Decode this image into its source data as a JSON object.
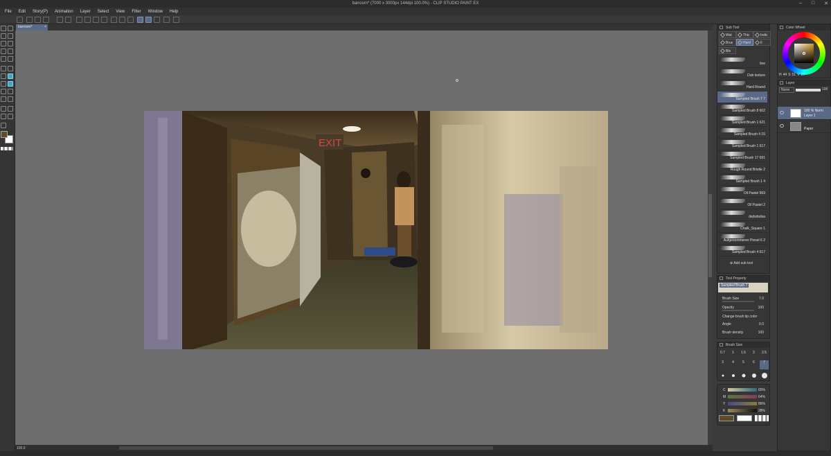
{
  "window": {
    "title": "barroom* (7000 x 3000px 144dpi 100.0%) - CLIP STUDIO PAINT EX",
    "controls": [
      "–",
      "□",
      "✕"
    ]
  },
  "menu": [
    "File",
    "Edit",
    "Story(P)",
    "Animation",
    "Layer",
    "Select",
    "View",
    "Filter",
    "Window",
    "Help"
  ],
  "document_tab": {
    "label": "barroom*",
    "close": "×"
  },
  "status": {
    "zoom": "100.0"
  },
  "colors": {
    "main_color": "#5e4c2a",
    "sub_color": "#ffffff",
    "accent": "#5a6a86",
    "canvas_bg": "#6d6d6d"
  },
  "sub_tool_panel": {
    "title": "Sub Tool",
    "tabs": [
      "Wat",
      "Thic",
      "Indic",
      "Brus",
      "Hard",
      "Il",
      "Ble"
    ],
    "brushes": [
      "line",
      "Dub texture",
      "Hard Round",
      "Sampled Brush 7 7",
      "Sampled Brush 8 602",
      "Sampled Brush 1 621",
      "Sampled Brush 4 15",
      "Sampled Brush 1 617",
      "Sampled Brush 17 691",
      "Rough Round Bristle 2",
      "Sampled Brush 1 4",
      "Oil Pastel 569",
      "Oil Pastel 2",
      "dsdsdsdsa",
      "Chalk_Square 1",
      "Aufgenommener Pinsel 6 2",
      "Sampled Brush 4 617"
    ],
    "selected_index": 3,
    "add_label": "Add sub tool"
  },
  "tool_property": {
    "title": "Tool Property",
    "brush_name": "Sampled Brush 7",
    "brush_size_label": "Brush Size",
    "brush_size": "7.0",
    "opacity_label": "Opacity",
    "opacity": "100",
    "change_tip_label": "Change brush tip color",
    "angle_label": "Angle",
    "angle": "0.0",
    "density_label": "Brush density",
    "density": "100"
  },
  "brush_size_panel": {
    "title": "Brush Size",
    "row1": [
      "0.7",
      "1",
      "1.5",
      "2",
      "2.5"
    ],
    "row2": [
      "3",
      "4",
      "5",
      "6",
      "7"
    ],
    "selected": "7"
  },
  "cmyk": {
    "rows": [
      {
        "k": "C",
        "v": "65%"
      },
      {
        "k": "M",
        "v": "64%"
      },
      {
        "k": "Y",
        "v": "86%"
      },
      {
        "k": "K",
        "v": "28%"
      }
    ]
  },
  "color_wheel": {
    "title": "Color Wheel",
    "h": "44",
    "s": "51",
    "v": "37",
    "labels": [
      "H",
      "S",
      "V"
    ]
  },
  "layer_panel": {
    "title": "Layer",
    "blend": "Norm",
    "opacity": "100",
    "layers": [
      {
        "l1": "100 % Norm",
        "l2": "Layer 1",
        "selected": true
      },
      {
        "l1": "",
        "l2": "Paper",
        "selected": false
      }
    ]
  }
}
